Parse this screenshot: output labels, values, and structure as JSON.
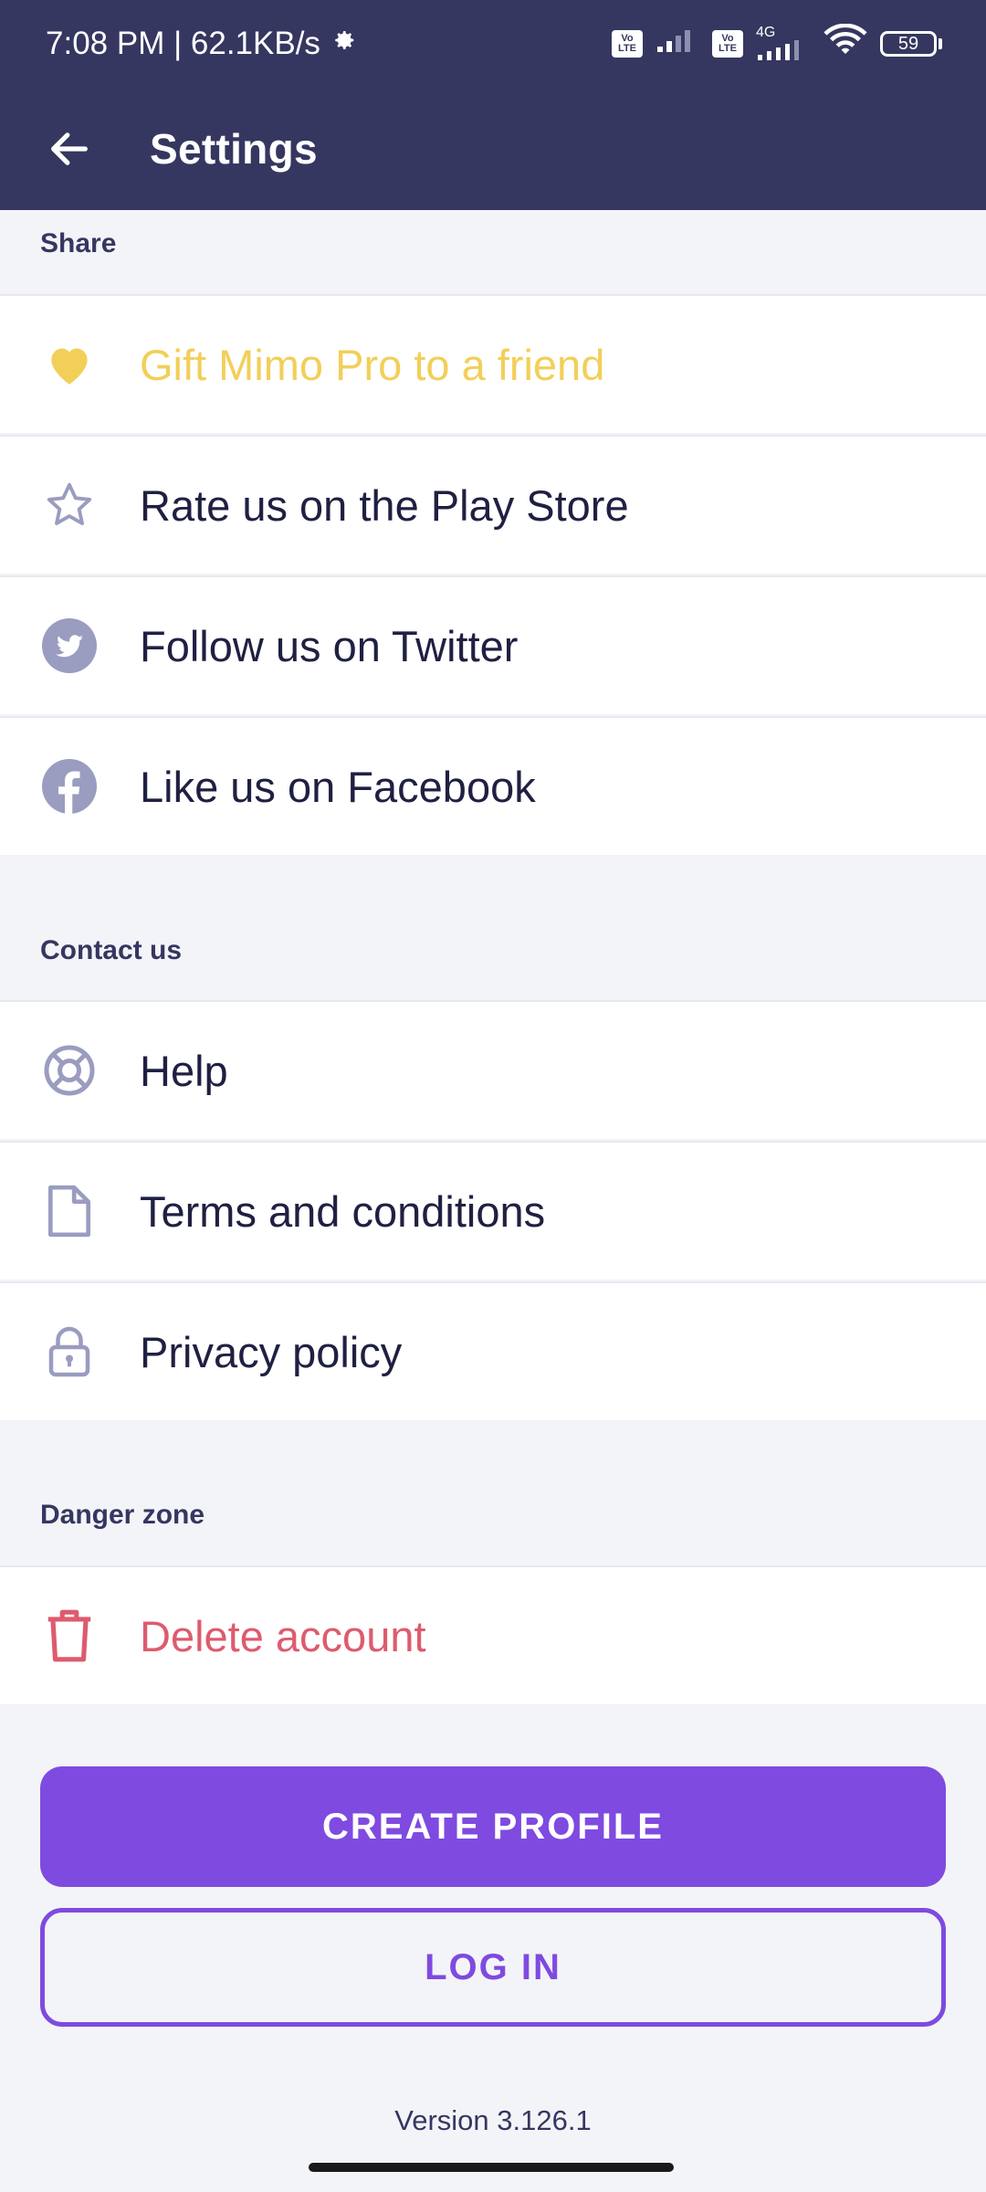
{
  "status_bar": {
    "time_speed": "7:08 PM | 62.1KB/s",
    "volte_label": "Vo LTE",
    "network_label": "4G",
    "battery": "59"
  },
  "header": {
    "title": "Settings"
  },
  "sections": {
    "share": {
      "title": "Share",
      "items": [
        {
          "label": "Gift Mimo Pro to a friend",
          "icon": "heart-icon"
        },
        {
          "label": "Rate us on the Play Store",
          "icon": "star-icon"
        },
        {
          "label": "Follow us on Twitter",
          "icon": "twitter-icon"
        },
        {
          "label": "Like us on Facebook",
          "icon": "facebook-icon"
        }
      ]
    },
    "contact": {
      "title": "Contact us",
      "items": [
        {
          "label": "Help",
          "icon": "lifebuoy-icon"
        },
        {
          "label": "Terms and conditions",
          "icon": "document-icon"
        },
        {
          "label": "Privacy policy",
          "icon": "lock-icon"
        }
      ]
    },
    "danger": {
      "title": "Danger zone",
      "items": [
        {
          "label": "Delete account",
          "icon": "trash-icon"
        }
      ]
    }
  },
  "buttons": {
    "create_profile": "CREATE PROFILE",
    "log_in": "LOG IN"
  },
  "version": "Version 3.126.1",
  "colors": {
    "header_bg": "#353760",
    "accent": "#7f4ae0",
    "gold": "#f2cf59",
    "danger": "#de5b6e",
    "icon_gray": "#9a9cc0"
  }
}
